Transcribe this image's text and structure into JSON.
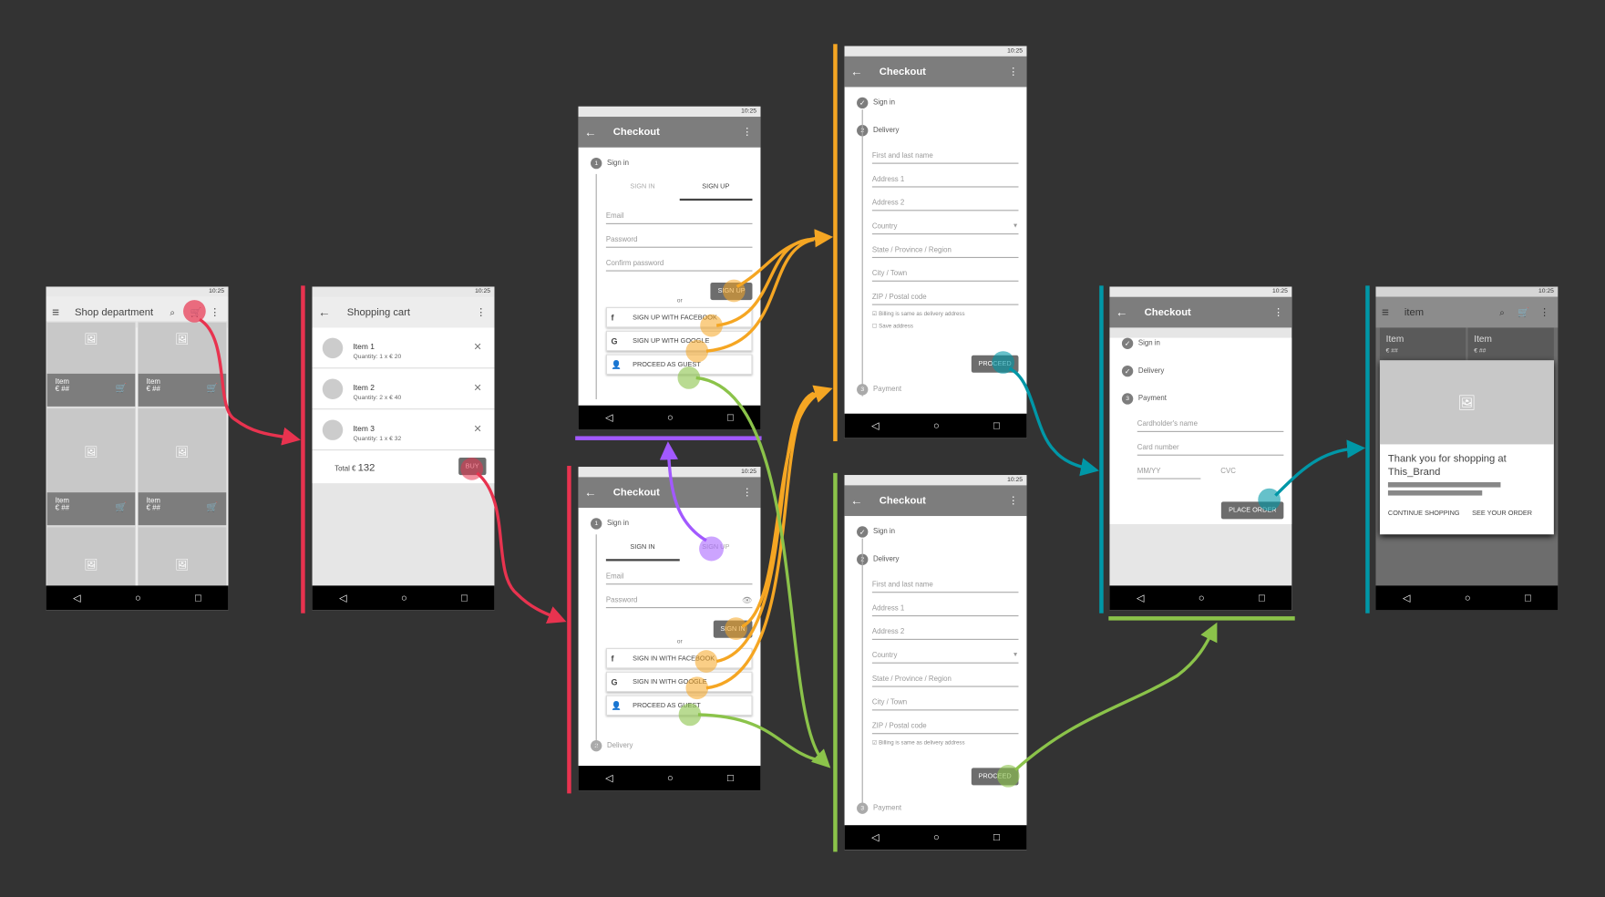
{
  "status_time": "10:25",
  "colors": {
    "red": "#e8334f",
    "orange": "#f5a623",
    "green": "#8bc34a",
    "teal": "#0097a7",
    "purple": "#a259ff"
  },
  "screen_shop": {
    "title": "Shop department",
    "items": [
      {
        "name": "Item",
        "price": "€ ##"
      },
      {
        "name": "Item",
        "price": "€ ##"
      },
      {
        "name": "Item",
        "price": "€ ##"
      },
      {
        "name": "Item",
        "price": "€ ##"
      }
    ]
  },
  "screen_cart": {
    "title": "Shopping cart",
    "items": [
      {
        "name": "Item 1",
        "qty": "Quantity: 1 x € 20"
      },
      {
        "name": "Item 2",
        "qty": "Quantity: 2 x € 40"
      },
      {
        "name": "Item 3",
        "qty": "Quantity: 1 x € 32"
      }
    ],
    "total_label": "Total €",
    "total_value": "132",
    "buy": "BUY"
  },
  "screen_signup": {
    "title": "Checkout",
    "step1": "Sign in",
    "tab_in": "SIGN IN",
    "tab_up": "SIGN UP",
    "email": "Email",
    "password": "Password",
    "confirm": "Confirm password",
    "submit": "SIGN UP",
    "or": "or",
    "facebook": "SIGN UP WITH FACEBOOK",
    "google": "SIGN UP WITH GOOGLE",
    "guest": "PROCEED AS GUEST"
  },
  "screen_signin": {
    "title": "Checkout",
    "step1": "Sign in",
    "tab_in": "SIGN IN",
    "tab_up": "SIGN UP",
    "email": "Email",
    "password": "Password",
    "submit": "SIGN IN",
    "or": "or",
    "facebook": "SIGN IN WITH FACEBOOK",
    "google": "SIGN IN WITH GOOGLE",
    "guest": "PROCEED AS GUEST",
    "step2": "Delivery"
  },
  "screen_delivery_a": {
    "title": "Checkout",
    "step1": "Sign in",
    "step2": "Delivery",
    "fields": [
      "First and last name",
      "Address 1",
      "Address 2",
      "Country",
      "State / Province / Region",
      "City / Town",
      "ZIP / Postal code"
    ],
    "check1": "Billing is same as delivery address",
    "check2": "Save address",
    "proceed": "PROCEED",
    "step3": "Payment"
  },
  "screen_delivery_b": {
    "title": "Checkout",
    "step1": "Sign in",
    "step2": "Delivery",
    "fields": [
      "First and last name",
      "Address 1",
      "Address 2",
      "Country",
      "State / Province / Region",
      "City / Town",
      "ZIP / Postal code"
    ],
    "check1": "Billing is same as delivery address",
    "proceed": "PROCEED",
    "step3": "Payment"
  },
  "screen_payment": {
    "title": "Checkout",
    "step1": "Sign in",
    "step2": "Delivery",
    "step3": "Payment",
    "cardholder": "Cardholder's name",
    "card": "Card number",
    "exp": "MM/YY",
    "cvc": "CVC",
    "place": "PLACE ORDER"
  },
  "screen_thanks": {
    "title": "item",
    "tile1": "Item",
    "tile1_price": "€ ##",
    "tile2": "Item",
    "tile2_price": "€ ##",
    "message": "Thank you for shopping at This_Brand",
    "continue": "CONTINUE SHOPPING",
    "see_order": "SEE YOUR ORDER"
  },
  "nav": {
    "back": "◁",
    "home": "○",
    "recent": "□"
  }
}
